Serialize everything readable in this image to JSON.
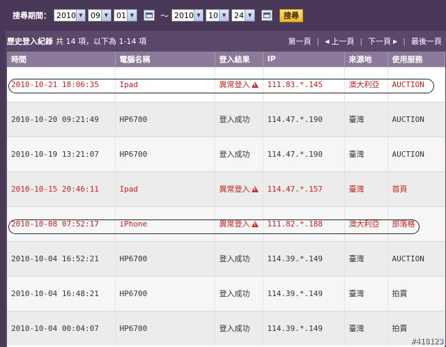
{
  "search": {
    "label": "搜尋期間：",
    "from_year": "2010",
    "from_month": "09",
    "from_day": "01",
    "separator": "～",
    "to_year": "2010",
    "to_month": "10",
    "to_day": "24",
    "button": "搜尋"
  },
  "records": {
    "title": "歷史登入紀錄",
    "count_text": "共 14 項，以下為 1-14 項",
    "pager": {
      "first": "第一頁",
      "prev": "上一頁",
      "next": "下一頁",
      "last": "最後一頁"
    }
  },
  "table": {
    "columns": [
      "時間",
      "電腦名稱",
      "登入結果",
      "IP",
      "來源地",
      "使用服務"
    ],
    "rows": [
      {
        "time": "2010-10-21 18:06:35",
        "device": "Ipad",
        "result": "異常登入",
        "ip": "111.83.*.145",
        "origin": "澳大利亞",
        "service": "AUCTION",
        "alert": true
      },
      {
        "time": "2010-10-20 09:21:49",
        "device": "HP6700",
        "result": "登入成功",
        "ip": "114.47.*.190",
        "origin": "臺灣",
        "service": "AUCTION",
        "alert": false
      },
      {
        "time": "2010-10-19 13:21:07",
        "device": "HP6700",
        "result": "登入成功",
        "ip": "114.47.*.190",
        "origin": "臺灣",
        "service": "AUCTION",
        "alert": false
      },
      {
        "time": "2010-10-15 20:46:11",
        "device": "Ipad",
        "result": "異常登入",
        "ip": "114.47.*.157",
        "origin": "臺灣",
        "service": "首頁",
        "alert": true
      },
      {
        "time": "2010-10-08 07:52:17",
        "device": "iPhone",
        "result": "異常登入",
        "ip": "111.82.*.188",
        "origin": "澳大利亞",
        "service": "部落格",
        "alert": true
      },
      {
        "time": "2010-10-04 16:52:21",
        "device": "HP6700",
        "result": "登入成功",
        "ip": "114.39.*.149",
        "origin": "臺灣",
        "service": "AUCTION",
        "alert": false
      },
      {
        "time": "2010-10-04 16:48:21",
        "device": "HP6700",
        "result": "登入成功",
        "ip": "114.39.*.149",
        "origin": "臺灣",
        "service": "拍賣",
        "alert": false
      },
      {
        "time": "2010-10-04 00:04:07",
        "device": "HP6700",
        "result": "登入成功",
        "ip": "114.39.*.149",
        "origin": "臺灣",
        "service": "拍賣",
        "alert": false
      }
    ]
  },
  "watermark": "#418123",
  "icons": {
    "warning": "warning-triangle-icon",
    "calendar": "calendar-icon",
    "dropdown": "chevron-down-icon"
  },
  "colors": {
    "alert_text": "#c81e1e",
    "header_bg": "#8c7a9a",
    "frame_bg": "#4a3858"
  }
}
